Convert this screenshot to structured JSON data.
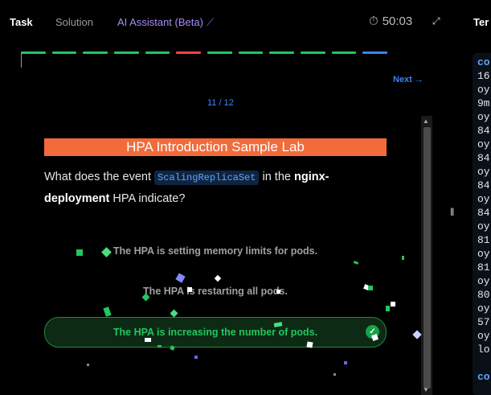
{
  "tabs": {
    "task": "Task",
    "solution": "Solution",
    "ai_assistant": "AI Assistant (Beta)"
  },
  "timer": {
    "value": "50:03",
    "icon": "timer-icon"
  },
  "terminal_tab": "Ter",
  "progress": {
    "segments": [
      "#22c55e",
      "#22c55e",
      "#22c55e",
      "#22c55e",
      "#22c55e",
      "#ef4444",
      "#22c55e",
      "#22c55e",
      "#22c55e",
      "#22c55e",
      "#22c55e",
      "#3b82f6"
    ]
  },
  "nav": {
    "next_label": "Next",
    "counter": "11 / 12"
  },
  "lab": {
    "title": "HPA Introduction Sample Lab",
    "question_prefix": "What does the event",
    "question_code": "ScalingReplicaSet",
    "question_mid": "in the",
    "question_bold": "nginx-deployment",
    "question_suffix": "HPA indicate?"
  },
  "options": [
    {
      "label": "The HPA is setting memory limits for pods.",
      "selected": false
    },
    {
      "label": "The HPA is restarting all pods.",
      "selected": false
    },
    {
      "label": "The HPA is increasing the number of pods.",
      "selected": true
    }
  ],
  "terminal": {
    "lines": [
      "co",
      "16",
      "oy",
      "9m",
      "oy",
      "84",
      "oy",
      "84",
      "oy",
      "84",
      "oy",
      "84",
      "oy",
      "81",
      "oy",
      "81",
      "oy",
      "80",
      "oy",
      "57",
      "oy",
      "lo",
      "",
      "co"
    ]
  },
  "colors": {
    "accent": "#3b82f6",
    "banner": "#f26b3a",
    "success": "#22c55e"
  }
}
